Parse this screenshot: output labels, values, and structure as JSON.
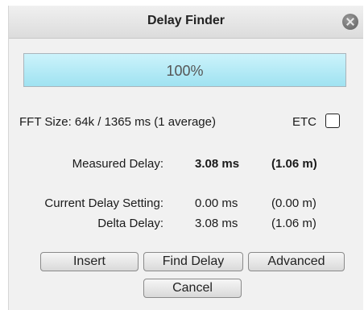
{
  "dialog": {
    "title": "Delay Finder",
    "progress": {
      "text": "100%",
      "value": 1.0
    },
    "fft_info": "FFT Size: 64k / 1365 ms (1 average)",
    "etc_label": "ETC",
    "etc_checked": false,
    "measured": {
      "label": "Measured Delay:",
      "ms": "3.08 ms",
      "m": "(1.06 m)"
    },
    "current": {
      "label": "Current Delay Setting:",
      "ms": "0.00 ms",
      "m": "(0.00 m)"
    },
    "delta": {
      "label": "Delta Delay:",
      "ms": "3.08 ms",
      "m": "(1.06 m)"
    },
    "buttons": {
      "insert": "Insert",
      "find_delay": "Find Delay",
      "advanced": "Advanced",
      "cancel": "Cancel"
    }
  }
}
